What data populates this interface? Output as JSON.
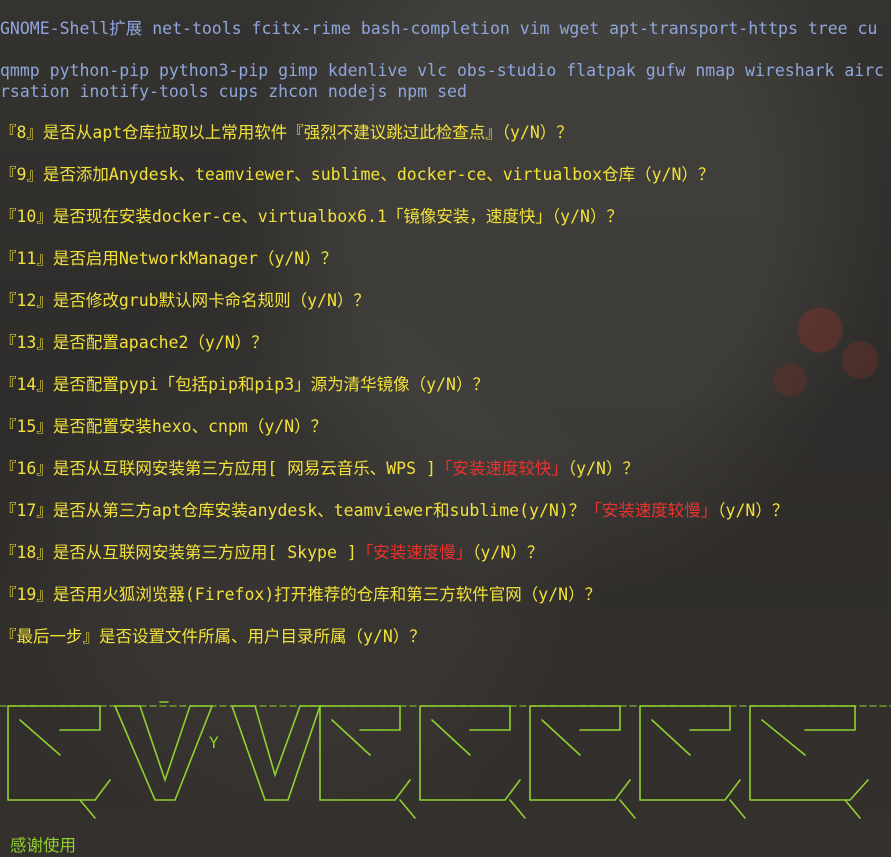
{
  "packages": {
    "line1": "GNOME-Shell扩展 net-tools fcitx-rime bash-completion vim wget apt-transport-https tree cu",
    "line2": "qmmp python-pip python3-pip gimp kdenlive vlc obs-studio flatpak gufw nmap wireshark airc",
    "line3": "rsation inotify-tools cups zhcon nodejs npm sed"
  },
  "questions": {
    "q8": "『8』是否从apt仓库拉取以上常用软件『强烈不建议跳过此检查点』（y/N）？",
    "q9": "『9』是否添加Anydesk、teamviewer、sublime、docker-ce、virtualbox仓库（y/N）？",
    "q10": "『10』是否现在安装docker-ce、virtualbox6.1「镜像安装，速度快」（y/N）？",
    "q11": "『11』是否启用NetworkManager（y/N）？",
    "q12": "『12』是否修改grub默认网卡命名规则（y/N）？",
    "q13": "『13』是否配置apache2（y/N）？",
    "q14": "『14』是否配置pypi「包括pip和pip3」源为清华镜像（y/N）？",
    "q15": "『15』是否配置安装hexo、cnpm（y/N）？",
    "q16": {
      "pre": "『16』是否从互联网安装第三方应用[ 网易云音乐、WPS ]",
      "red": "「安装速度较快」",
      "post": "（y/N）？"
    },
    "q17": {
      "pre": "『17』是否从第三方apt仓库安装anydesk、teamviewer和sublime(y/N)？",
      "red": "「安装速度较慢」",
      "post": "（y/N）？"
    },
    "q18": {
      "pre": "『18』是否从互联网安装第三方应用[ Skype ]",
      "red": "「安装速度慢」",
      "post": "（y/N）？"
    },
    "q19": "『19』是否用火狐浏览器(Firefox)打开推荐的仓库和第三方软件官网（y/N）？",
    "last": "『最后一步』是否设置文件所属、用户目录所属（y/N）？"
  },
  "banner": {
    "stray_char": "Y",
    "color": "#8fd02e"
  },
  "footer": {
    "thanks": "感谢使用"
  },
  "colors": {
    "package_text": "#8fa6dc",
    "question_text": "#f2e13a",
    "warning_text": "#e8332e",
    "banner_text": "#8fd02e"
  }
}
